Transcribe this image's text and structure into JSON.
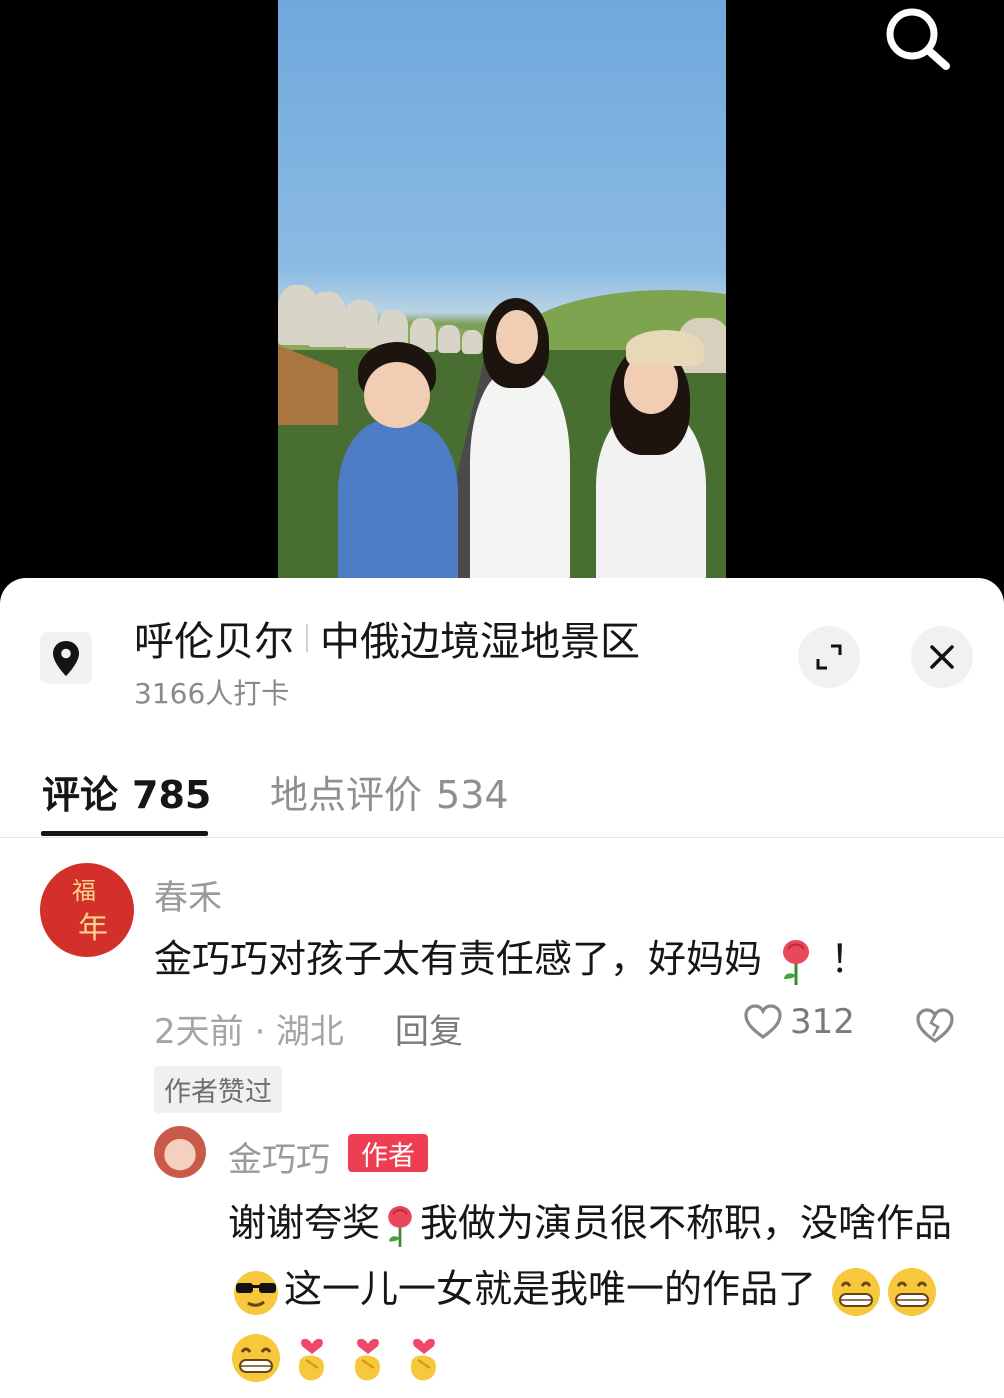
{
  "location": {
    "city": "呼伦贝尔",
    "scenic_spot": "中俄边境湿地景区",
    "checkins": "3166人打卡"
  },
  "tabs": [
    {
      "label": "评论",
      "count": "785"
    },
    {
      "label": "地点评价",
      "count": "534"
    }
  ],
  "comment": {
    "username": "春禾",
    "avatar_text_1": "福",
    "avatar_text_2": "年",
    "text": "金巧巧对孩子太有责任感了，好妈妈",
    "text_suffix": "！",
    "time_location": "2天前 · 湖北",
    "reply_label": "回复",
    "likes": "312",
    "author_liked_tag": "作者赞过"
  },
  "reply": {
    "username": "金巧巧",
    "badge": "作者",
    "text_part1": "谢谢夸奖",
    "text_part2": "我做为演员很不称职，没啥作品",
    "text_part3": "这一儿一女就是我唯一的作品了"
  },
  "colors": {
    "badge_red": "#ee3e52",
    "text_primary": "#161616",
    "text_secondary": "#9a9a9a"
  },
  "icons": [
    "search-icon",
    "location-pin-icon",
    "expand-icon",
    "close-icon",
    "heart-icon",
    "broken-heart-icon",
    "rose-emoji",
    "cool-face-emoji",
    "grin-emoji",
    "finger-heart-emoji"
  ]
}
